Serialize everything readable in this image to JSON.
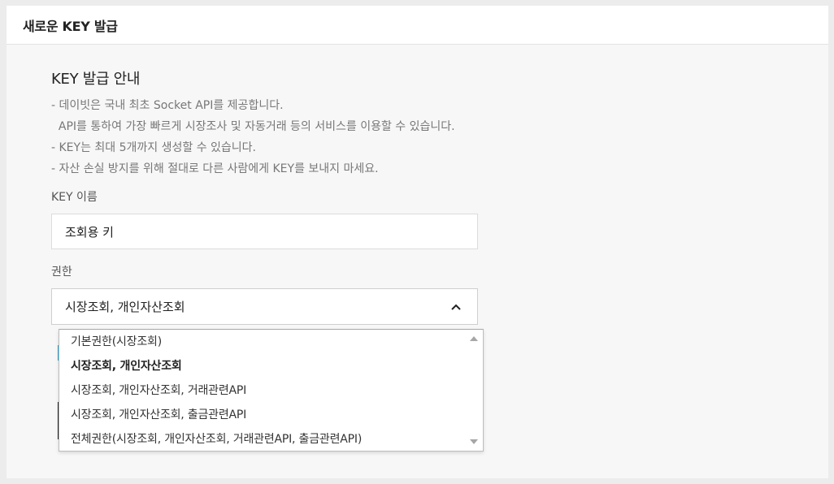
{
  "panel": {
    "title": "새로운 KEY 발급"
  },
  "guide": {
    "title": "KEY 발급 안내",
    "lines": [
      "- 데이빗은 국내 최초 Socket API를 제공합니다.",
      "  API를 통하여 가장 빠르게 시장조사 및 자동거래 등의 서비스를 이용할 수 있습니다.",
      "- KEY는 최대 5개까지 생성할 수 있습니다.",
      "- 자산 손실 방지를 위해 절대로 다른 사람에게 KEY를 보내지 마세요."
    ]
  },
  "key_name": {
    "label": "KEY 이름",
    "value": "조회용 키"
  },
  "permission": {
    "label": "권한",
    "selected": "시장조회, 개인자산조회",
    "options": [
      "기본권한(시장조회)",
      "시장조회, 개인자산조회",
      "시장조회, 개인자산조회, 거래관련API",
      "시장조회, 개인자산조회, 출금관련API",
      "전체권한(시장조회, 개인자산조회, 거래관련API, 출금관련API)"
    ],
    "selected_index": 1
  },
  "colors": {
    "accent": "#2aa7e0",
    "background": "#ececec",
    "panel": "#f7f7f7"
  },
  "icons": {
    "select_toggle": "chevron-up-icon"
  }
}
